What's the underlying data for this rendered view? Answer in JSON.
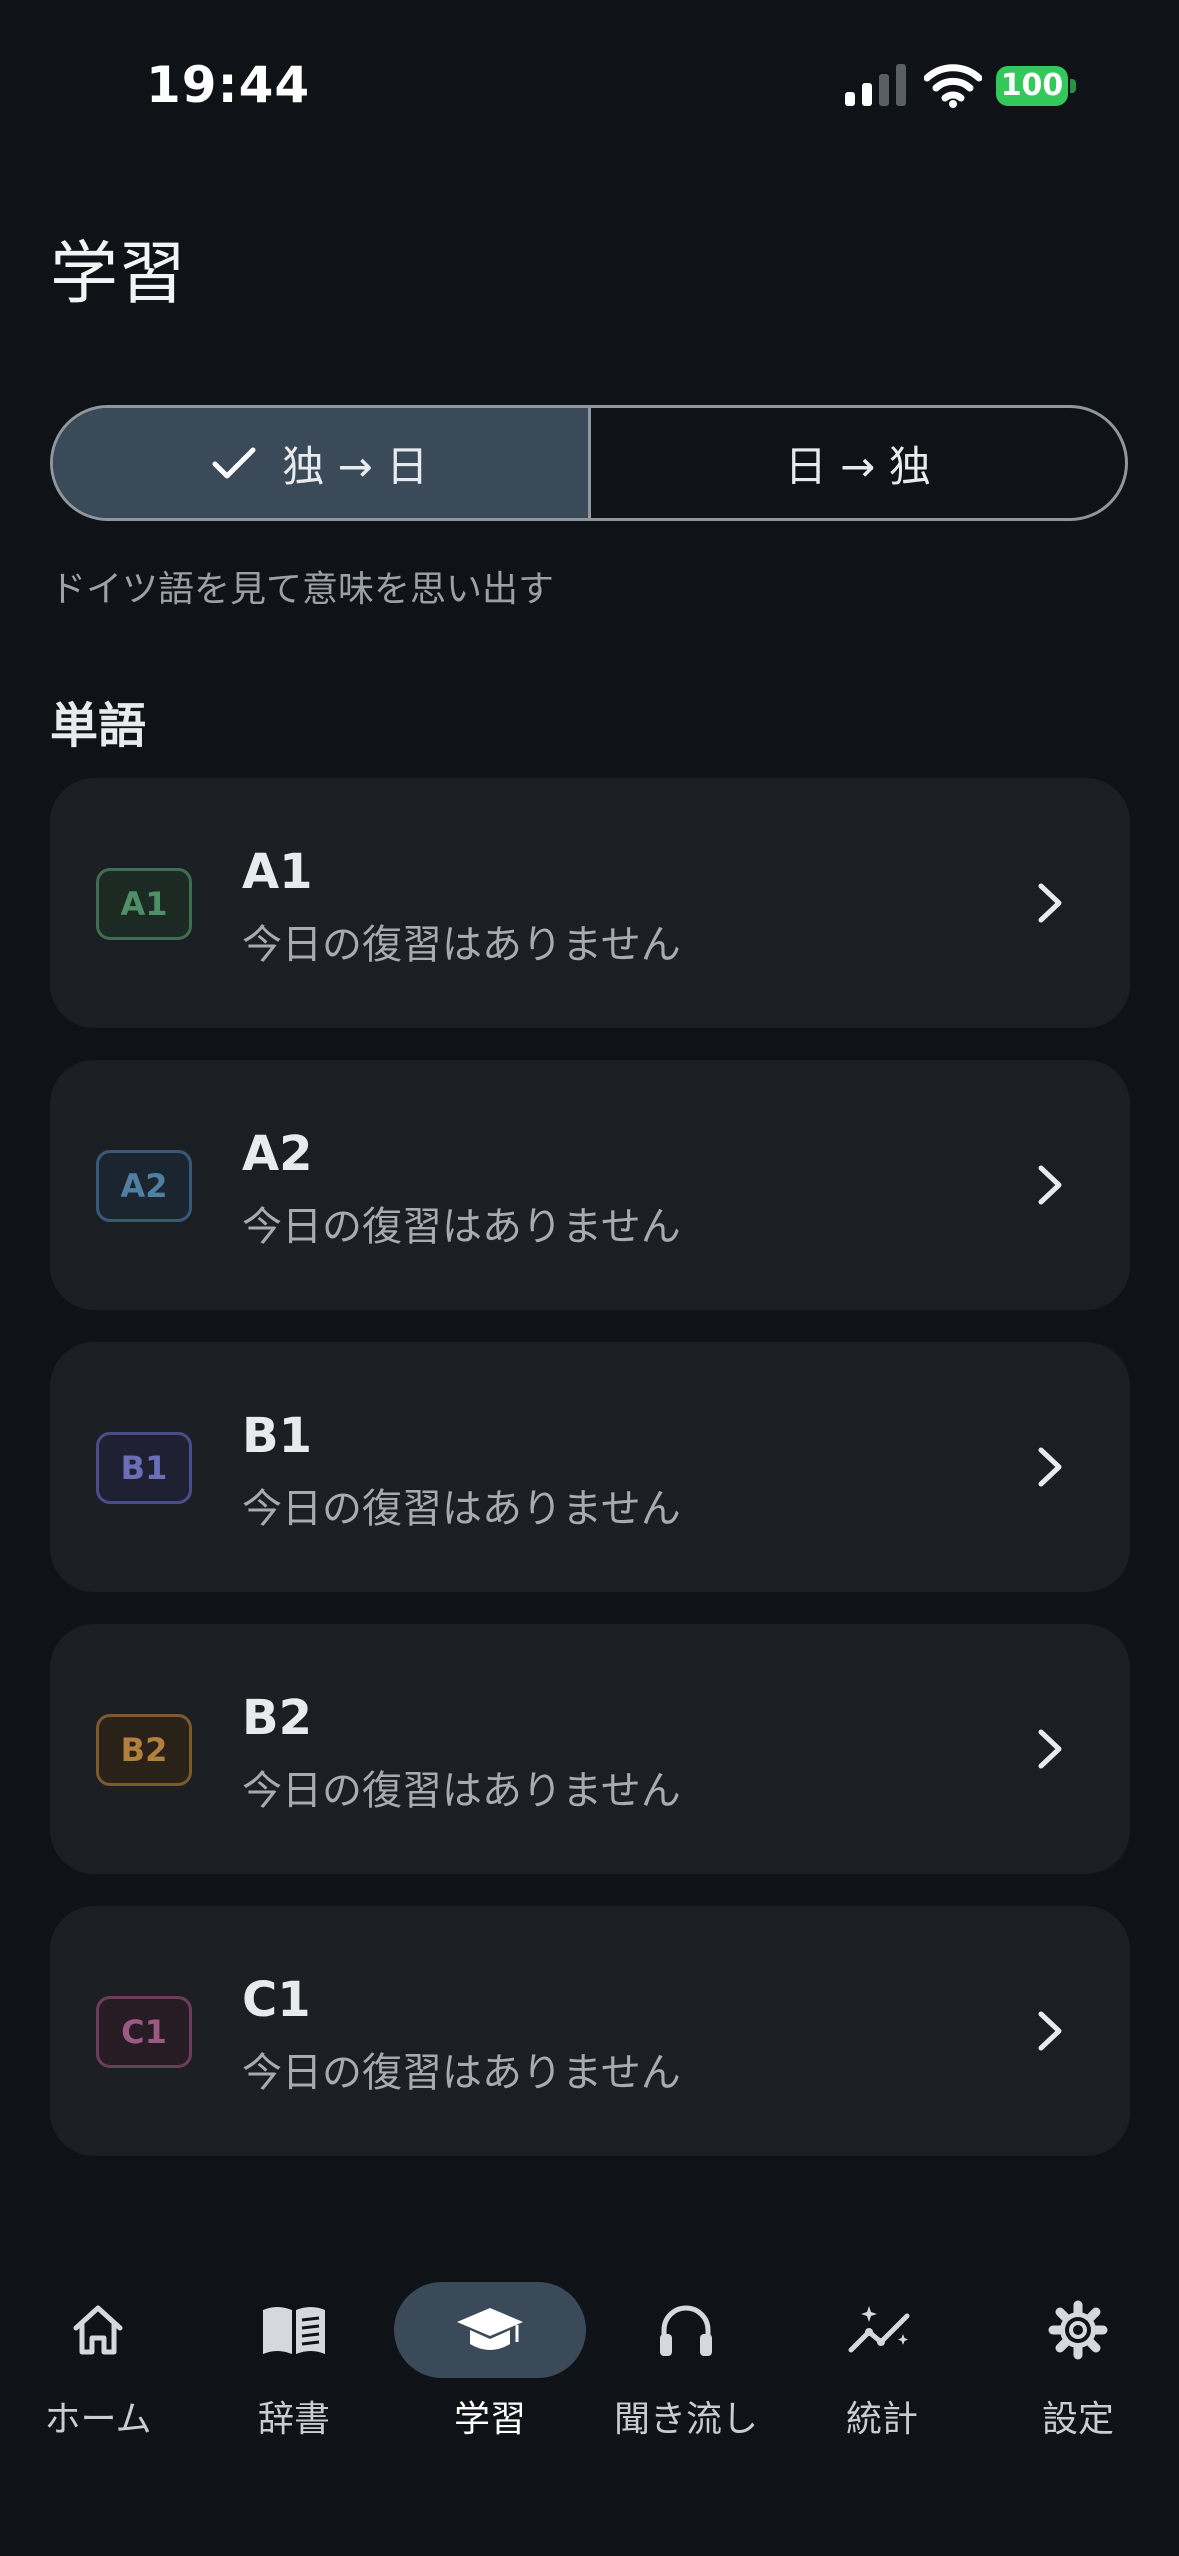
{
  "status": {
    "time": "19:44",
    "battery": "100"
  },
  "page": {
    "title": "学習"
  },
  "direction": {
    "options": [
      {
        "label": "独 → 日",
        "selected": true
      },
      {
        "label": "日 → 独",
        "selected": false
      }
    ],
    "hint": "ドイツ語を見て意味を思い出す"
  },
  "section": {
    "title": "単語"
  },
  "levels": [
    {
      "badge": "A1",
      "title": "A1",
      "subtitle": "今日の復習はありません",
      "color": "#4f8f68"
    },
    {
      "badge": "A2",
      "title": "A2",
      "subtitle": "今日の復習はありません",
      "color": "#4f7fa3"
    },
    {
      "badge": "B1",
      "title": "B1",
      "subtitle": "今日の復習はありません",
      "color": "#6a6fb8"
    },
    {
      "badge": "B2",
      "title": "B2",
      "subtitle": "今日の復習はありません",
      "color": "#b0803c"
    },
    {
      "badge": "C1",
      "title": "C1",
      "subtitle": "今日の復習はありません",
      "color": "#9a5a82"
    }
  ],
  "tabbar": {
    "items": [
      {
        "label": "ホーム",
        "icon": "home-icon",
        "active": false
      },
      {
        "label": "辞書",
        "icon": "book-icon",
        "active": false
      },
      {
        "label": "学習",
        "icon": "graduation-cap-icon",
        "active": true
      },
      {
        "label": "聞き流し",
        "icon": "headphones-icon",
        "active": false
      },
      {
        "label": "統計",
        "icon": "stats-icon",
        "active": false
      },
      {
        "label": "設定",
        "icon": "gear-icon",
        "active": false
      }
    ]
  }
}
